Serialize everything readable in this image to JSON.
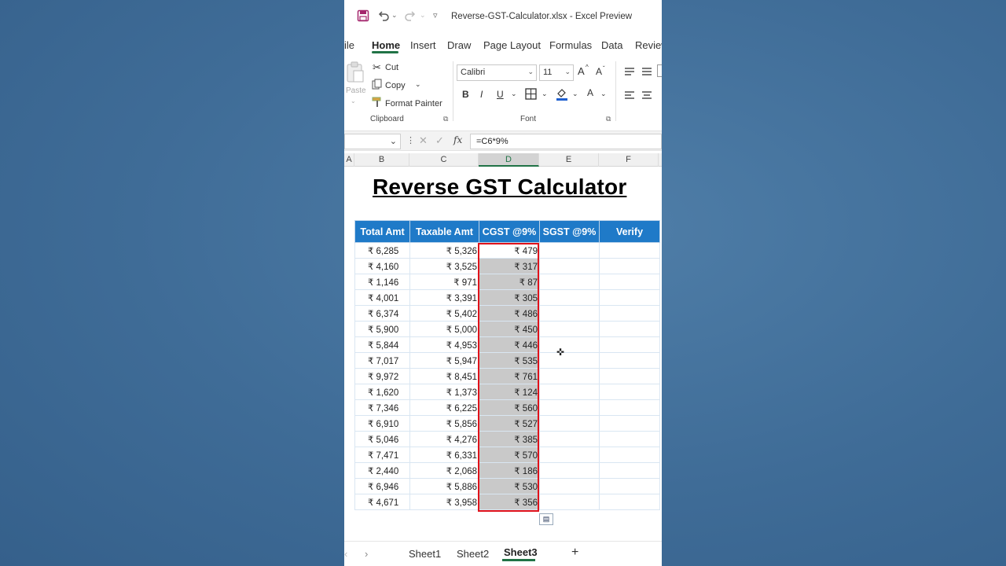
{
  "window": {
    "title": "Reverse-GST-Calculator.xlsx  -  Excel Preview"
  },
  "quick_access": {
    "save_icon": "save-icon",
    "undo_icon": "undo-icon",
    "redo_icon": "redo-icon",
    "customize_icon": "customize-qat-icon"
  },
  "tabs": [
    "ile",
    "Home",
    "Insert",
    "Draw",
    "Page Layout",
    "Formulas",
    "Data",
    "Review"
  ],
  "active_tab": "Home",
  "ribbon": {
    "paste_label": "Paste",
    "cut_label": "Cut",
    "copy_label": "Copy",
    "format_painter_label": "Format Painter",
    "clipboard_group": "Clipboard",
    "font_name": "Calibri",
    "font_size": "11",
    "grow_font": "A",
    "shrink_font": "A",
    "bold": "B",
    "italic": "I",
    "underline": "U",
    "font_color_letter": "A",
    "font_group": "Font"
  },
  "formula_bar": {
    "fx": "fx",
    "formula": "=C6*9%"
  },
  "column_headers": [
    "A",
    "B",
    "C",
    "D",
    "E",
    "F"
  ],
  "selected_column": "D",
  "sheet": {
    "title": "Reverse GST Calculator",
    "headers": [
      "Total Amt",
      "Taxable Amt",
      "CGST @9%",
      "SGST @9%",
      "Verify"
    ],
    "rows": [
      [
        "₹ 6,285",
        "₹ 5,326",
        "₹ 479"
      ],
      [
        "₹ 4,160",
        "₹ 3,525",
        "₹ 317"
      ],
      [
        "₹ 1,146",
        "₹ 971",
        "₹ 87"
      ],
      [
        "₹ 4,001",
        "₹ 3,391",
        "₹ 305"
      ],
      [
        "₹ 6,374",
        "₹ 5,402",
        "₹ 486"
      ],
      [
        "₹ 5,900",
        "₹ 5,000",
        "₹ 450"
      ],
      [
        "₹ 5,844",
        "₹ 4,953",
        "₹ 446"
      ],
      [
        "₹ 7,017",
        "₹ 5,947",
        "₹ 535"
      ],
      [
        "₹ 9,972",
        "₹ 8,451",
        "₹ 761"
      ],
      [
        "₹ 1,620",
        "₹ 1,373",
        "₹ 124"
      ],
      [
        "₹ 7,346",
        "₹ 6,225",
        "₹ 560"
      ],
      [
        "₹ 6,910",
        "₹ 5,856",
        "₹ 527"
      ],
      [
        "₹ 5,046",
        "₹ 4,276",
        "₹ 385"
      ],
      [
        "₹ 7,471",
        "₹ 6,331",
        "₹ 570"
      ],
      [
        "₹ 2,440",
        "₹ 2,068",
        "₹ 186"
      ],
      [
        "₹ 6,946",
        "₹ 5,886",
        "₹ 530"
      ],
      [
        "₹ 4,671",
        "₹ 3,958",
        "₹ 356"
      ]
    ]
  },
  "sheet_tabs": [
    "Sheet1",
    "Sheet2",
    "Sheet3"
  ],
  "active_sheet": "Sheet3",
  "add_sheet": "+",
  "colors": {
    "header_blue": "#1f7ac8",
    "selection_red": "#e0121b",
    "excel_green": "#217346",
    "selected_fill": "#c9c9c9"
  }
}
